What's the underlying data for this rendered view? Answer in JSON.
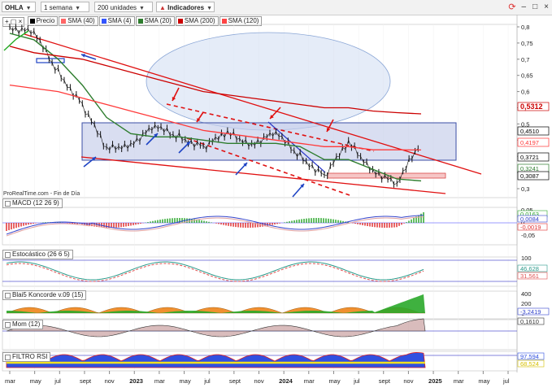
{
  "toolbar": {
    "symbol": "OHLA",
    "period": "1 semana",
    "units": "200 unidades",
    "indicators_label": "Indicadores",
    "win_min": "–",
    "win_max": "□",
    "win_close": "×",
    "refresh_icon": "refresh-icon"
  },
  "main_panel": {
    "legend": [
      {
        "label": "Precio",
        "color": "#000000"
      },
      {
        "label": "SMA (40)",
        "color": "#ff6666"
      },
      {
        "label": "SMA (4)",
        "color": "#3355ff"
      },
      {
        "label": "SMA (20)",
        "color": "#2e7d2e"
      },
      {
        "label": "SMA (200)",
        "color": "#cc0000"
      },
      {
        "label": "SMA (120)",
        "color": "#ff4444"
      }
    ],
    "watermark": "ProRealTime.com - Fin de Día",
    "y_ticks": [
      "0,8",
      "0,75",
      "0,7",
      "0,65",
      "0,6",
      "0,55",
      "0,5",
      "0,45",
      "0,4",
      "0,35",
      "0,3"
    ],
    "price_labels": [
      {
        "text": "0,5312",
        "color": "#cc0000"
      },
      {
        "text": "0,4510",
        "color": "#000000"
      },
      {
        "text": "0,4197",
        "color": "#ff3333"
      },
      {
        "text": "0,3721",
        "color": "#000000"
      },
      {
        "text": "0,3241",
        "color": "#2e7d2e"
      },
      {
        "text": "0,3087",
        "color": "#000000"
      }
    ]
  },
  "panels": {
    "macd": {
      "title": "MACD (12 26 9)",
      "ticks": [
        "0,05",
        "0",
        "-0,05"
      ],
      "labels": [
        "0,0163",
        "0,0084",
        "-0,0019"
      ]
    },
    "stoch": {
      "title": "Estocástico (26 6 5)",
      "ticks": [
        "100"
      ],
      "labels": [
        "46,628",
        "31,561"
      ]
    },
    "koncorde": {
      "title": "Blai5 Koncorde v.09 (15)",
      "ticks": [
        "400",
        "200",
        "0"
      ],
      "labels": [
        "-3,2419"
      ]
    },
    "mom": {
      "title": "Mom (12)",
      "labels": [
        "0,1610"
      ]
    },
    "rsi": {
      "title": "FILTRO RSI",
      "labels": [
        "97,594",
        "68,524"
      ]
    }
  },
  "x_axis": [
    "mar",
    "may",
    "jul",
    "sept",
    "nov",
    "2023",
    "mar",
    "may",
    "jul",
    "sept",
    "nov",
    "2024",
    "mar",
    "may",
    "jul",
    "sept",
    "nov",
    "2025",
    "mar",
    "may",
    "jul"
  ],
  "chart_data": {
    "type": "line",
    "title": "OHLA",
    "xlabel": "",
    "ylabel": "",
    "ylim": [
      0.28,
      0.82
    ],
    "x": [
      "2022-03",
      "2022-05",
      "2022-07",
      "2022-09",
      "2022-11",
      "2023-01",
      "2023-03",
      "2023-05",
      "2023-07",
      "2023-09",
      "2023-11",
      "2024-01",
      "2024-03",
      "2024-05",
      "2024-07",
      "2024-09",
      "2024-11",
      "2025-01"
    ],
    "series": [
      {
        "name": "Precio",
        "values": [
          0.8,
          0.78,
          0.66,
          0.56,
          0.42,
          0.44,
          0.49,
          0.46,
          0.43,
          0.47,
          0.44,
          0.47,
          0.4,
          0.34,
          0.44,
          0.36,
          0.31,
          0.451
        ]
      },
      {
        "name": "SMA (20)",
        "values": [
          0.78,
          0.76,
          0.7,
          0.62,
          0.52,
          0.47,
          0.46,
          0.46,
          0.45,
          0.44,
          0.44,
          0.44,
          0.43,
          0.39,
          0.39,
          0.36,
          0.33,
          0.3241
        ]
      },
      {
        "name": "SMA (200)",
        "values": [
          0.74,
          0.72,
          0.71,
          0.7,
          0.68,
          0.66,
          0.64,
          0.62,
          0.6,
          0.59,
          0.58,
          0.57,
          0.56,
          0.55,
          0.55,
          0.54,
          0.535,
          0.5312
        ]
      },
      {
        "name": "SMA (120)",
        "values": [
          0.62,
          0.61,
          0.6,
          0.58,
          0.56,
          0.54,
          0.52,
          0.5,
          0.48,
          0.47,
          0.46,
          0.45,
          0.44,
          0.43,
          0.43,
          0.42,
          0.42,
          0.4197
        ]
      }
    ]
  }
}
